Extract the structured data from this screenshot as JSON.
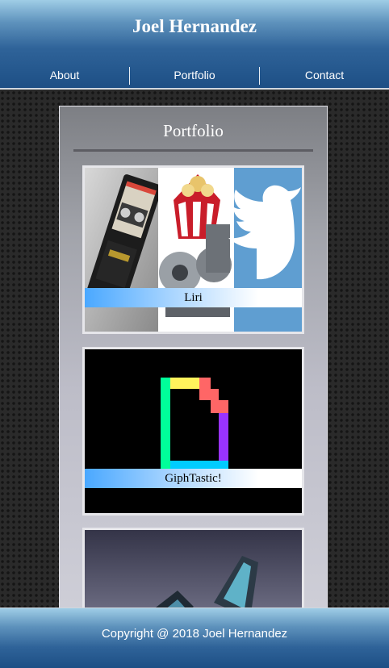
{
  "header": {
    "title": "Joel Hernandez"
  },
  "nav": {
    "items": [
      {
        "label": "About"
      },
      {
        "label": "Portfolio"
      },
      {
        "label": "Contact"
      }
    ]
  },
  "portfolio": {
    "heading": "Portfolio",
    "projects": [
      {
        "label": "Liri",
        "images": [
          "cassette-tape-image",
          "movie-film-reel-image",
          "twitter-bird-icon"
        ]
      },
      {
        "label": "GiphTastic!",
        "images": [
          "giphy-logo-icon"
        ]
      },
      {
        "label": "",
        "images": [
          "crystal-gem-image"
        ]
      }
    ]
  },
  "footer": {
    "copyright": "Copyright @ 2018 Joel Hernandez"
  },
  "colors": {
    "header_blue": "#1d4f85",
    "label_blue": "#4aa8ff",
    "twitter_blue": "#5f9ed1"
  }
}
